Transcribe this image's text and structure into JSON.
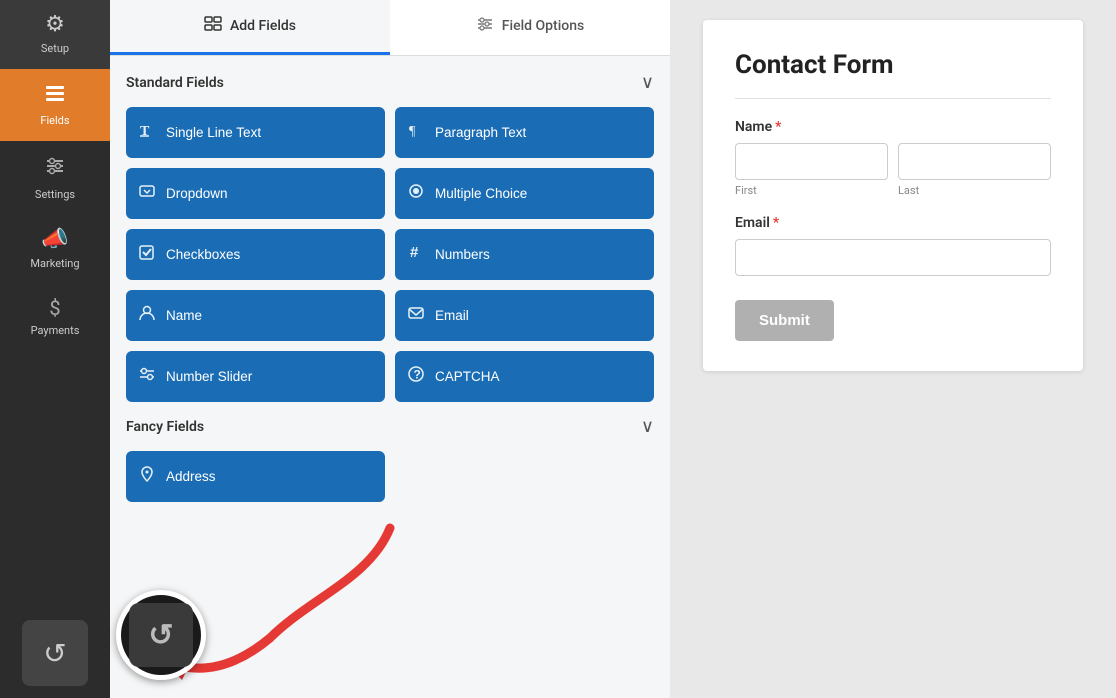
{
  "sidebar": {
    "items": [
      {
        "id": "setup",
        "label": "Setup",
        "icon": "⚙",
        "active": false
      },
      {
        "id": "fields",
        "label": "Fields",
        "icon": "≡",
        "active": true
      },
      {
        "id": "settings",
        "label": "Settings",
        "icon": "⊞",
        "active": false
      },
      {
        "id": "marketing",
        "label": "Marketing",
        "icon": "📣",
        "active": false
      },
      {
        "id": "payments",
        "label": "Payments",
        "icon": "$",
        "active": false
      }
    ],
    "undo_icon": "↺"
  },
  "tabs": [
    {
      "id": "add-fields",
      "label": "Add Fields",
      "icon": "▦",
      "active": true
    },
    {
      "id": "field-options",
      "label": "Field Options",
      "icon": "⚙",
      "active": false
    }
  ],
  "standard_fields": {
    "section_title": "Standard Fields",
    "buttons": [
      {
        "id": "single-line-text",
        "label": "Single Line Text",
        "icon": "T̲"
      },
      {
        "id": "paragraph-text",
        "label": "Paragraph Text",
        "icon": "¶"
      },
      {
        "id": "dropdown",
        "label": "Dropdown",
        "icon": "⊡"
      },
      {
        "id": "multiple-choice",
        "label": "Multiple Choice",
        "icon": "◎"
      },
      {
        "id": "checkboxes",
        "label": "Checkboxes",
        "icon": "☑"
      },
      {
        "id": "numbers",
        "label": "Numbers",
        "icon": "#"
      },
      {
        "id": "name",
        "label": "Name",
        "icon": "👤"
      },
      {
        "id": "email",
        "label": "Email",
        "icon": "✉"
      },
      {
        "id": "number-slider",
        "label": "Number Slider",
        "icon": "⊞"
      },
      {
        "id": "captcha",
        "label": "CAPTCHA",
        "icon": "?"
      }
    ]
  },
  "fancy_fields": {
    "section_title": "Fancy Fields",
    "buttons": [
      {
        "id": "address",
        "label": "Address",
        "icon": "📍"
      }
    ]
  },
  "form_preview": {
    "title": "Contact Form",
    "fields": [
      {
        "id": "name",
        "label": "Name",
        "required": true,
        "type": "name",
        "sub_labels": [
          "First",
          "Last"
        ]
      },
      {
        "id": "email",
        "label": "Email",
        "required": true,
        "type": "email"
      }
    ],
    "submit_label": "Submit"
  }
}
